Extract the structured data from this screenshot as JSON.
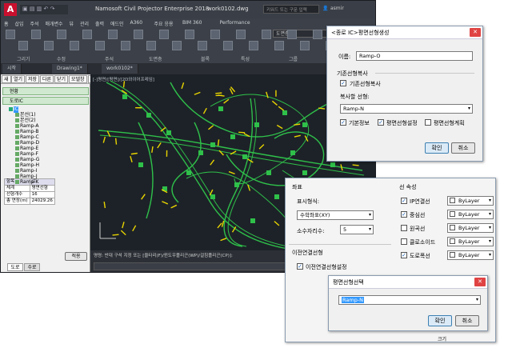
{
  "window": {
    "title": "Namosoft Civil Projector Enterprise 2018",
    "file": "work0102.dwg",
    "search_text": "키워드 또는 구문 입력",
    "user": "asmir"
  },
  "ribbon": {
    "tabs": [
      "홈",
      "삽입",
      "주석",
      "매개변수",
      "뷰",
      "관리",
      "출력",
      "애드인",
      "A360",
      "주요 응용",
      "BIM 360",
      "Performance"
    ],
    "groups": [
      "그리기",
      "수정",
      "주석",
      "도면층",
      "블록",
      "특성",
      "그룹"
    ],
    "layer_value": "도면층"
  },
  "doc_tabs": [
    "시작",
    "Drawing1*",
    "work0102*"
  ],
  "viewport_header": "[-]평면/[평면]/[2D와이어프레임]",
  "left_panel": {
    "toolbar": [
      "새",
      "열기",
      "저장",
      "다른",
      "닫기",
      "모델창",
      "닫기",
      "단면관리"
    ],
    "sections": [
      "현황",
      "도로IC"
    ],
    "tree": [
      "IC",
      "본선(1)",
      "본선(2)",
      "Ramp-A",
      "Ramp-B",
      "Ramp-C",
      "Ramp-D",
      "Ramp-E",
      "Ramp-F",
      "Ramp-G",
      "Ramp-H",
      "Ramp-I",
      "Ramp-J",
      "Ramp-K"
    ],
    "prop_headers": [
      "항목",
      "값"
    ],
    "prop_rows": [
      [
        "체계",
        "평면선형"
      ],
      [
        "선형개수",
        "16"
      ],
      [
        "총 연장(m)",
        "24029.26"
      ]
    ],
    "bottom_tabs": [
      "도로",
      "수로"
    ],
    "apply_button": "적용"
  },
  "cmdline": {
    "text": "명령: 반대 구석 지정 또는 [울타리(F)/윈도우폴리곤(WP)/걸침폴리곤(CP)]:",
    "model_tab": "모형",
    "layout1": "배치1",
    "layout2": "배치2"
  },
  "dlg1": {
    "title": "<종로 IC>평면선형생성",
    "name_label": "이름:",
    "name_value": "Ramp-O",
    "group_title": "기존선형복사",
    "copy_check_label": "기존선형복사",
    "copy_select_label": "복사할 선형:",
    "copy_select_value": "Ramp-N",
    "opt1": "기본정보",
    "opt2": "평면선형설정",
    "opt3": "평면선형계획",
    "ok": "확인",
    "cancel": "취소"
  },
  "dlg2": {
    "coord_section": "좌표",
    "display_label": "표시형식:",
    "display_value": "수학좌표(XY)",
    "decimal_label": "소수자리수:",
    "decimal_value": "5",
    "prev_section": "이전연결선형",
    "prev_check": "이전연결선형설정",
    "line_section": "선 속성",
    "line_items": [
      {
        "label": "IP연결선",
        "checked": true,
        "value": "ByLayer"
      },
      {
        "label": "중심선",
        "checked": true,
        "value": "ByLayer"
      },
      {
        "label": "원곡선",
        "checked": false,
        "value": "ByLayer"
      },
      {
        "label": "클로소이드",
        "checked": false,
        "value": "ByLayer"
      },
      {
        "label": "도로폭선",
        "checked": true,
        "value": "ByLayer"
      }
    ],
    "bottom_label": "크기"
  },
  "dlg3": {
    "title": "평면선형선택",
    "select_value": "Ramp-N",
    "ok": "확인",
    "cancel": "취소"
  },
  "colors": {
    "road_green": "#2fc04a",
    "marker_yellow": "#e8d400",
    "cad_dark": "#1d2228",
    "check_mark": "#1a5fb4"
  }
}
